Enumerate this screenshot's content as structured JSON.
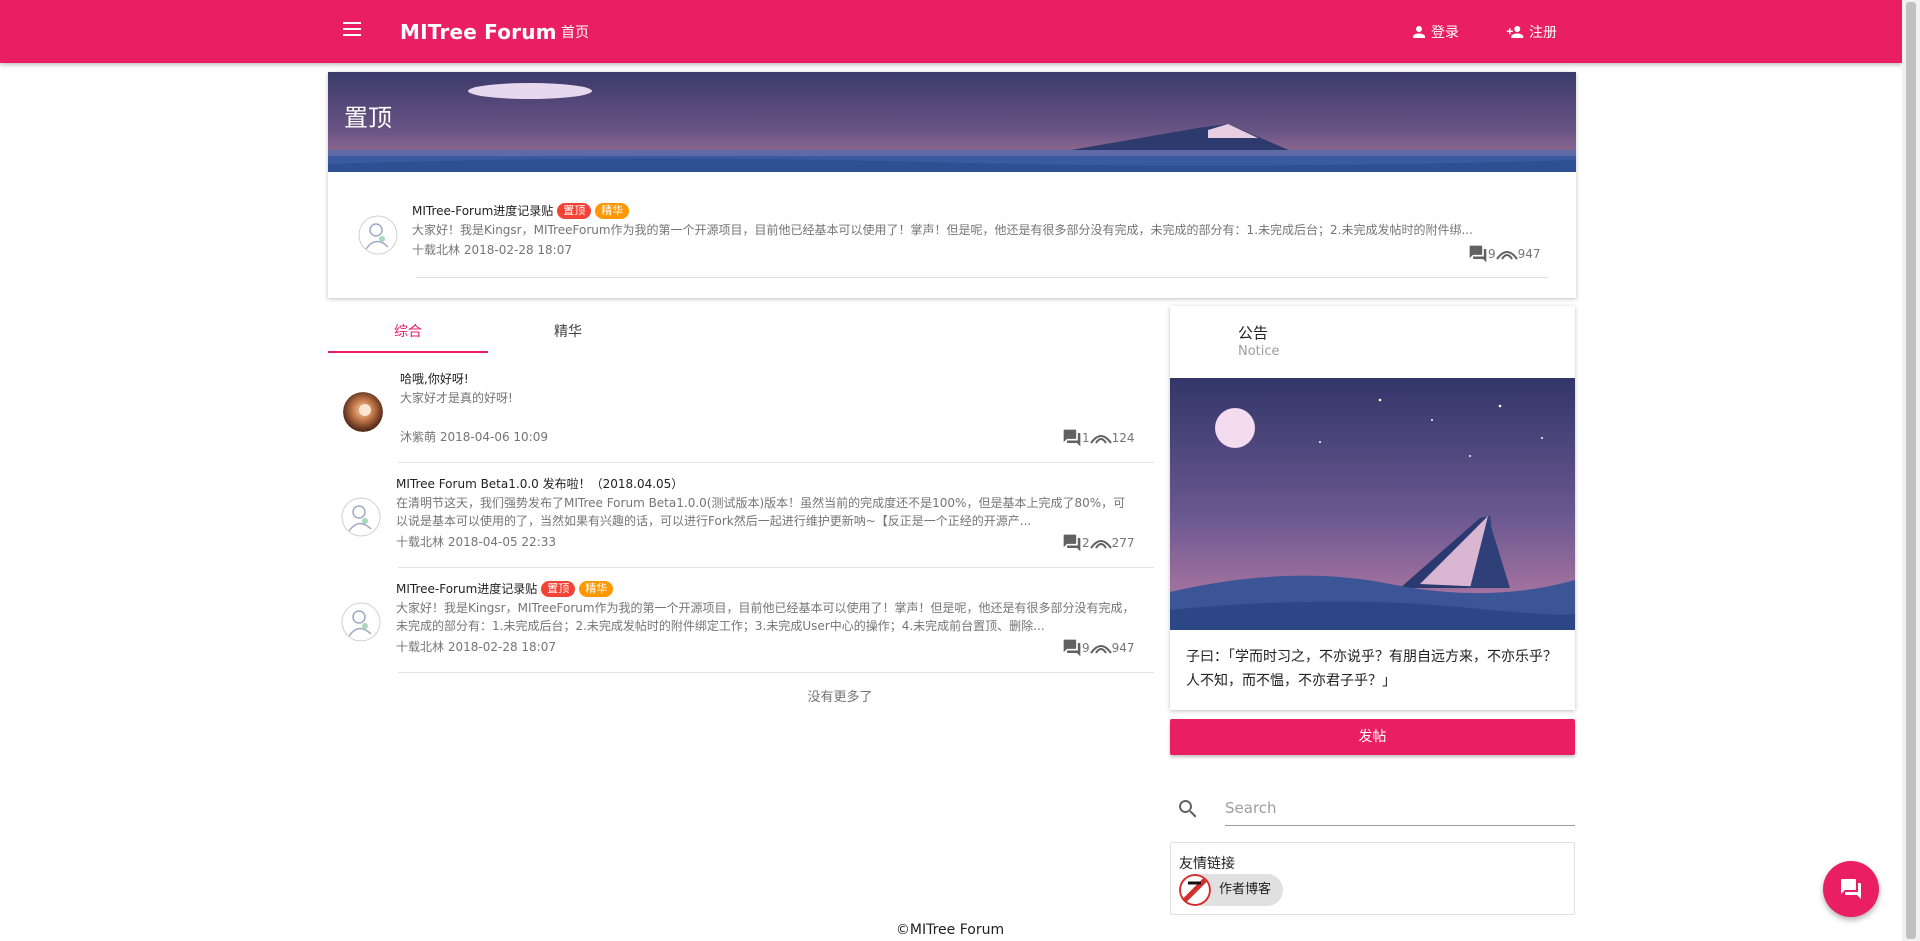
{
  "appbar": {
    "brand": "MITree Forum",
    "home_label": "首页",
    "login_label": "登录",
    "register_label": "注册",
    "color": "#e91e63"
  },
  "pinned": {
    "title": "置顶",
    "post": {
      "title": "MITree-Forum进度记录贴",
      "tag_top": "置顶",
      "tag_best": "精华",
      "excerpt": "大家好！我是Kingsr，MITreeForum作为我的第一个开源项目，目前他已经基本可以使用了！掌声！但是呢，他还是有很多部分没有完成，未完成的部分有：1.未完成后台；2.未完成发帖时的附件绑...",
      "author": "十载北林",
      "time": "2018-02-28 18:07",
      "comments": "9",
      "views": "947"
    }
  },
  "tabs": [
    "综合",
    "精华"
  ],
  "posts": [
    {
      "title": "哈哦,你好呀!",
      "excerpt": "大家好才是真的好呀!",
      "author": "沐紫萌",
      "time": "2018-04-06 10:09",
      "comments": "1",
      "views": "124"
    },
    {
      "title": "MITree Forum Beta1.0.0 发布啦！（2018.04.05）",
      "excerpt": "在清明节这天，我们强势发布了MITree Forum Beta1.0.0(测试版本)版本！虽然当前的完成度还不是100%，但是基本上完成了80%，可以说是基本可以使用的了，当然如果有兴趣的话，可以进行Fork然后一起进行维护更新呐~【反正是一个正经的开源产...",
      "author": "十载北林",
      "time": "2018-04-05 22:33",
      "comments": "2",
      "views": "277"
    },
    {
      "title": "MITree-Forum进度记录贴",
      "tag_top": "置顶",
      "tag_best": "精华",
      "excerpt": "大家好！我是Kingsr，MITreeForum作为我的第一个开源项目，目前他已经基本可以使用了！掌声！但是呢，他还是有很多部分没有完成，未完成的部分有：1.未完成后台；2.未完成发帖时的附件绑定工作；3.未完成User中心的操作；4.未完成前台置顶、删除...",
      "author": "十载北林",
      "time": "2018-02-28 18:07",
      "comments": "9",
      "views": "947"
    }
  ],
  "no_more": "没有更多了",
  "notice": {
    "title": "公告",
    "subtitle": "Notice",
    "text": "子曰：「学而时习之，不亦说乎？有朋自远方来，不亦乐乎？人不知，而不愠，不亦君子乎？」"
  },
  "post_button": "发帖",
  "search": {
    "placeholder": "Search"
  },
  "links": {
    "title": "友情链接",
    "items": [
      "作者博客"
    ]
  },
  "footer": "©MITree Forum"
}
